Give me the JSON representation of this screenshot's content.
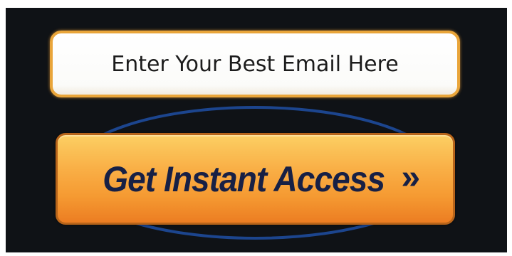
{
  "email_form": {
    "email_placeholder": "Enter Your Best Email Here",
    "submit_label": "Get Instant Access",
    "submit_icon": "double-chevron-right-icon",
    "submit_icon_glyph": "»"
  },
  "colors": {
    "background": "#0f1216",
    "field_border": "#e9a53a",
    "button_top": "#fccf63",
    "button_bottom": "#ec7d22",
    "button_text": "#172045",
    "ring": "#1f4fa3"
  }
}
